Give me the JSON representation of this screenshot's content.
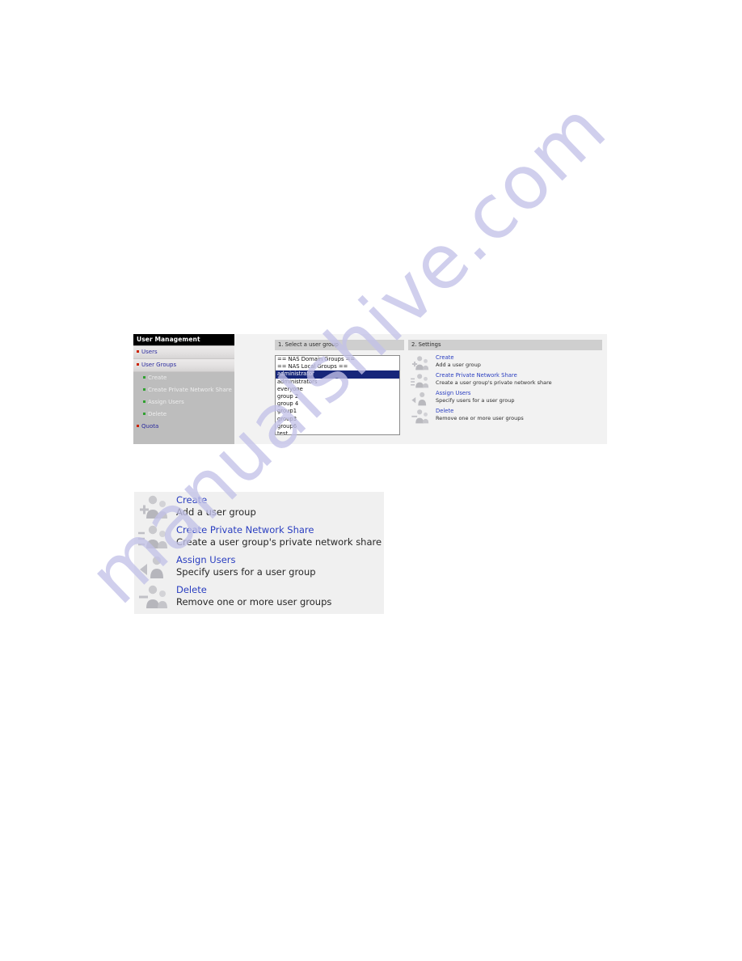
{
  "watermark": {
    "text": "manualshive.com"
  },
  "figure_admin_page": {
    "sidebar": {
      "title": "User Management",
      "items": [
        {
          "label": "Users",
          "level": "top",
          "bullet": "bullet-red-icon"
        },
        {
          "label": "User Groups",
          "level": "top",
          "bullet": "bullet-red-icon"
        },
        {
          "label": "Create",
          "level": "sub",
          "bullet": "bullet-green-icon"
        },
        {
          "label": "Create Private Network Share",
          "level": "sub",
          "bullet": "bullet-green-icon"
        },
        {
          "label": "Assign Users",
          "level": "sub",
          "bullet": "bullet-green-icon"
        },
        {
          "label": "Delete",
          "level": "sub",
          "bullet": "bullet-green-icon"
        },
        {
          "label": "Quota",
          "level": "bottom",
          "bullet": "bullet-red-icon"
        }
      ]
    },
    "select_group": {
      "header": "1. Select a user group",
      "options": [
        {
          "label": "== NAS Domain Groups ==",
          "selected": false
        },
        {
          "label": "== NAS Local Groups ==",
          "selected": false
        },
        {
          "label": "administrator",
          "selected": true
        },
        {
          "label": "administrators",
          "selected": false
        },
        {
          "label": "everyone",
          "selected": false
        },
        {
          "label": "group 2",
          "selected": false
        },
        {
          "label": "group 4",
          "selected": false
        },
        {
          "label": "group1",
          "selected": false
        },
        {
          "label": "group3",
          "selected": false
        },
        {
          "label": "group6",
          "selected": false
        },
        {
          "label": "test",
          "selected": false
        }
      ]
    },
    "settings": {
      "header": "2. Settings",
      "actions": [
        {
          "title": "Create",
          "desc": "Add a user group",
          "icon": "add-user-group-icon"
        },
        {
          "title": "Create Private Network Share",
          "desc": "Create a user group's private network share",
          "icon": "network-share-group-icon"
        },
        {
          "title": "Assign Users",
          "desc": "Specify users for a user group",
          "icon": "assign-users-icon"
        },
        {
          "title": "Delete",
          "desc": "Remove one or more user groups",
          "icon": "remove-user-group-icon"
        }
      ]
    }
  },
  "figure_settings_zoom": {
    "actions": [
      {
        "title": "Create",
        "desc": "Add a user group",
        "icon": "add-user-group-icon"
      },
      {
        "title": "Create Private Network Share",
        "desc": "Create a user group's private network share",
        "icon": "network-share-group-icon"
      },
      {
        "title": "Assign Users",
        "desc": "Specify users for a user group",
        "icon": "assign-users-icon"
      },
      {
        "title": "Delete",
        "desc": "Remove one or more user groups",
        "icon": "remove-user-group-icon"
      }
    ]
  },
  "colors": {
    "link_blue": "#2a3ec0",
    "selection_blue": "#16267a",
    "bullet_red": "#cc2200",
    "bullet_green": "#2fa12f",
    "watermark_lavender": "#c3c2e8",
    "panel_gray": "#f2f2f2",
    "sidebar_gray": "#bdbdbd",
    "header_gray": "#cfcfcf"
  }
}
